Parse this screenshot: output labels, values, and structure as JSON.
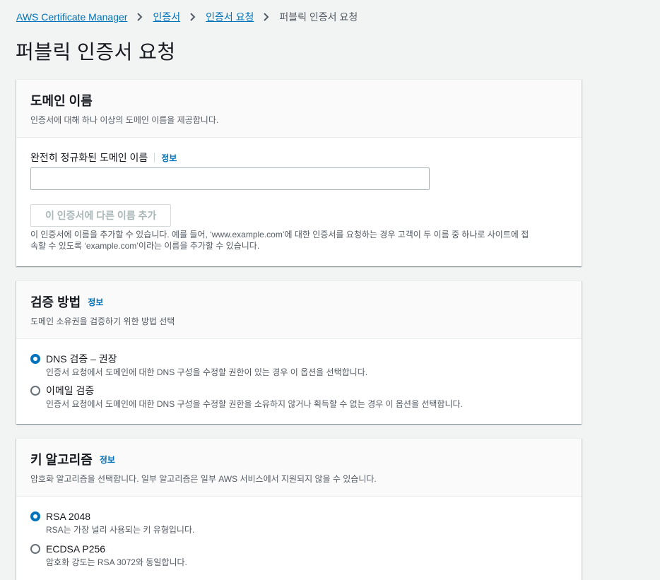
{
  "breadcrumb": {
    "items": [
      "AWS Certificate Manager",
      "인증서",
      "인증서 요청"
    ],
    "current": "퍼블릭 인증서 요청"
  },
  "page_title": "퍼블릭 인증서 요청",
  "info_label": "정보",
  "domain_section": {
    "title": "도메인 이름",
    "description": "인증서에 대해 하나 이상의 도메인 이름을 제공합니다.",
    "field_label": "완전히 정규화된 도메인 이름",
    "input_value": "",
    "add_button": "이 인증서에 다른 이름 추가",
    "helper_line1": "이 인증서에 이름을 추가할 수 있습니다. 예를 들어, ‘www.example.com’에 대한 인증서를 요청하는 경우 고객이 두 이름 중 하나로 사이트에 접",
    "helper_line2": "속할 수 있도록 ‘example.com’이라는 이름을 추가할 수 있습니다."
  },
  "validation_section": {
    "title": "검증 방법",
    "description": "도메인 소유권을 검증하기 위한 방법 선택",
    "options": [
      {
        "label": "DNS 검증 – 권장",
        "description": "인증서 요청에서 도메인에 대한 DNS 구성을 수정할 권한이 있는 경우 이 옵션을 선택합니다.",
        "selected": true
      },
      {
        "label": "이메일 검증",
        "description": "인증서 요청에서 도메인에 대한 DNS 구성을 수정할 권한을 소유하지 않거나 획득할 수 없는 경우 이 옵션을 선택합니다.",
        "selected": false
      }
    ]
  },
  "key_section": {
    "title": "키 알고리즘",
    "description": "암호화 알고리즘을 선택합니다. 일부 알고리즘은 일부 AWS 서비스에서 지원되지 않을 수 있습니다.",
    "options": [
      {
        "label": "RSA 2048",
        "description": "RSA는 가장 널리 사용되는 키 유형입니다.",
        "selected": true
      },
      {
        "label": "ECDSA P256",
        "description": "암호화 강도는 RSA 3072와 동일합니다.",
        "selected": false
      }
    ]
  },
  "colors": {
    "link": "#0073bb",
    "background": "#f2f3f3",
    "text": "#16191f",
    "muted": "#545b64"
  },
  "icons": {
    "breadcrumb_separator": "chevron-right-icon"
  }
}
